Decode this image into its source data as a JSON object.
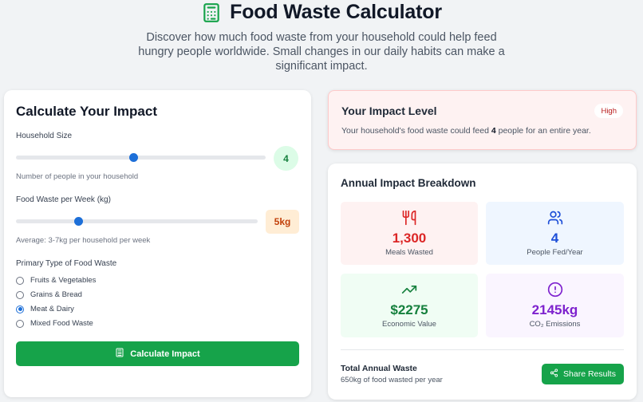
{
  "header": {
    "title": "Food Waste Calculator",
    "subtitle": "Discover how much food waste from your household could help feed hungry people worldwide. Small changes in our daily habits can make a significant impact.",
    "icon": "calculator-icon"
  },
  "calculator": {
    "title": "Calculate Your Impact",
    "household": {
      "label": "Household Size",
      "value": "4",
      "help": "Number of people in your household",
      "slider_fraction": 0.47
    },
    "waste": {
      "label": "Food Waste per Week (kg)",
      "value": "5kg",
      "help": "Average: 3-7kg per household per week",
      "slider_fraction": 0.26
    },
    "type": {
      "label": "Primary Type of Food Waste",
      "options": [
        "Fruits & Vegetables",
        "Grains & Bread",
        "Meat & Dairy",
        "Mixed Food Waste"
      ],
      "selected": "Meat & Dairy"
    },
    "button_label": "Calculate Impact"
  },
  "impact": {
    "title": "Your Impact Level",
    "level": "High",
    "text_before": "Your household's food waste could feed ",
    "people": "4",
    "text_after": " people for an entire year."
  },
  "breakdown": {
    "title": "Annual Impact Breakdown",
    "stats": [
      {
        "value": "1,300",
        "label": "Meals Wasted",
        "icon": "utensils-icon",
        "color": "#dc2626"
      },
      {
        "value": "4",
        "label": "People Fed/Year",
        "icon": "users-icon",
        "color": "#1d4ed8"
      },
      {
        "value": "$2275",
        "label": "Economic Value",
        "icon": "trending-up-icon",
        "color": "#15803d"
      },
      {
        "value": "2145kg",
        "label": "CO₂ Emissions",
        "icon": "alert-circle-icon",
        "color": "#7e22ce"
      }
    ],
    "total_title": "Total Annual Waste",
    "total_sub": "650kg of food wasted per year",
    "share_label": "Share Results"
  },
  "colors": {
    "primary_green": "#16a34a",
    "slider_blue": "#1d6fd8",
    "impact_bg": "#fef2f2"
  }
}
